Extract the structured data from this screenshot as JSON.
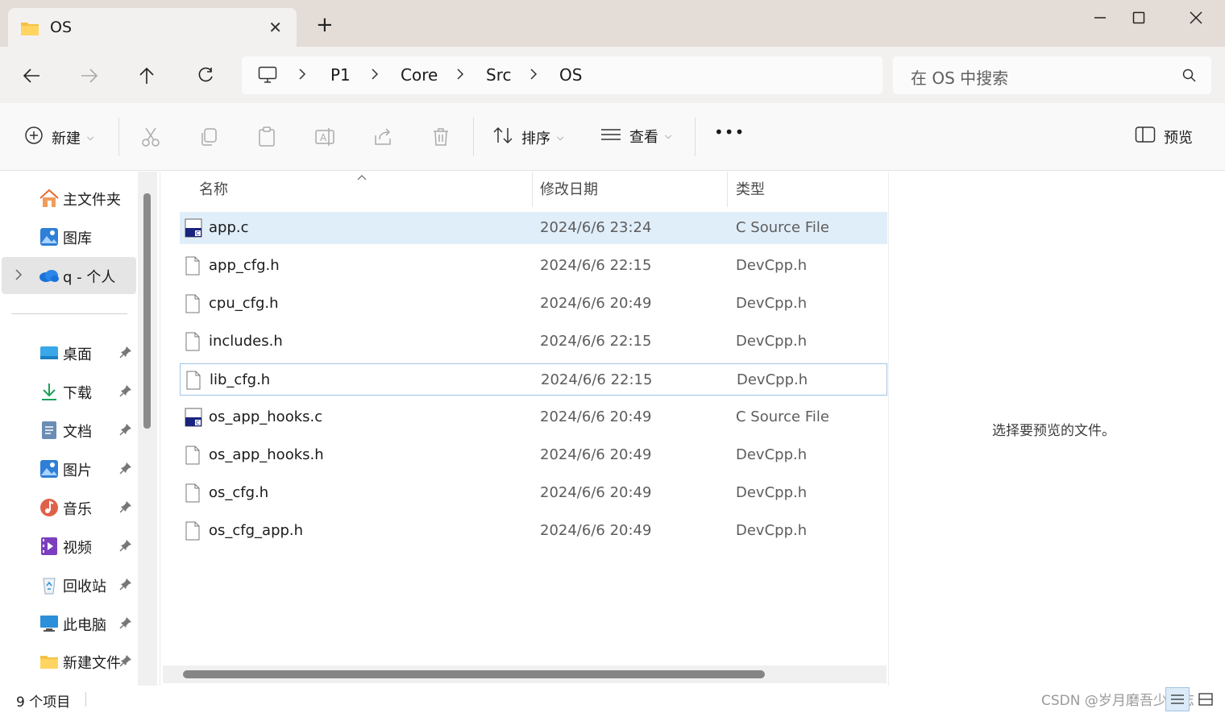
{
  "window": {
    "tab_title": "OS",
    "new_tab": "+"
  },
  "address": {
    "crumbs": [
      "P1",
      "Core",
      "Src",
      "OS"
    ],
    "search_placeholder": "在 OS 中搜索"
  },
  "toolbar": {
    "new_label": "新建",
    "sort_label": "排序",
    "view_label": "查看",
    "more_label": "•••",
    "preview_label": "预览"
  },
  "sidebar": {
    "items": [
      {
        "label": "主文件夹",
        "icon": "home-icon"
      },
      {
        "label": "图库",
        "icon": "gallery-icon"
      },
      {
        "label": "q - 个人",
        "icon": "onedrive-icon"
      },
      {
        "label": "桌面",
        "icon": "desktop-icon"
      },
      {
        "label": "下载",
        "icon": "download-icon"
      },
      {
        "label": "文档",
        "icon": "documents-icon"
      },
      {
        "label": "图片",
        "icon": "pictures-icon"
      },
      {
        "label": "音乐",
        "icon": "music-icon"
      },
      {
        "label": "视频",
        "icon": "videos-icon"
      },
      {
        "label": "回收站",
        "icon": "recycle-bin-icon"
      },
      {
        "label": "此电脑",
        "icon": "this-pc-icon"
      },
      {
        "label": "新建文件夹",
        "icon": "folder-icon"
      }
    ]
  },
  "filelist": {
    "columns": [
      "名称",
      "修改日期",
      "类型"
    ],
    "rows": [
      {
        "name": "app.c",
        "date": "2024/6/6 23:24",
        "type": "C Source File",
        "icon": "c-source-icon"
      },
      {
        "name": "app_cfg.h",
        "date": "2024/6/6 22:15",
        "type": "DevCpp.h",
        "icon": "file-icon"
      },
      {
        "name": "cpu_cfg.h",
        "date": "2024/6/6 20:49",
        "type": "DevCpp.h",
        "icon": "file-icon"
      },
      {
        "name": "includes.h",
        "date": "2024/6/6 22:15",
        "type": "DevCpp.h",
        "icon": "file-icon"
      },
      {
        "name": "lib_cfg.h",
        "date": "2024/6/6 22:15",
        "type": "DevCpp.h",
        "icon": "file-icon"
      },
      {
        "name": "os_app_hooks.c",
        "date": "2024/6/6 20:49",
        "type": "C Source File",
        "icon": "c-source-icon"
      },
      {
        "name": "os_app_hooks.h",
        "date": "2024/6/6 20:49",
        "type": "DevCpp.h",
        "icon": "file-icon"
      },
      {
        "name": "os_cfg.h",
        "date": "2024/6/6 20:49",
        "type": "DevCpp.h",
        "icon": "file-icon"
      },
      {
        "name": "os_cfg_app.h",
        "date": "2024/6/6 20:49",
        "type": "DevCpp.h",
        "icon": "file-icon"
      }
    ]
  },
  "preview": {
    "message": "选择要预览的文件。"
  },
  "status": {
    "item_count": "9 个项目",
    "watermark": "CSDN @岁月磨吾少年志"
  },
  "colors": {
    "titlebar": "#e4dcd7",
    "selected_row": "#e0eef9",
    "focus_border": "#9ec4e7"
  }
}
